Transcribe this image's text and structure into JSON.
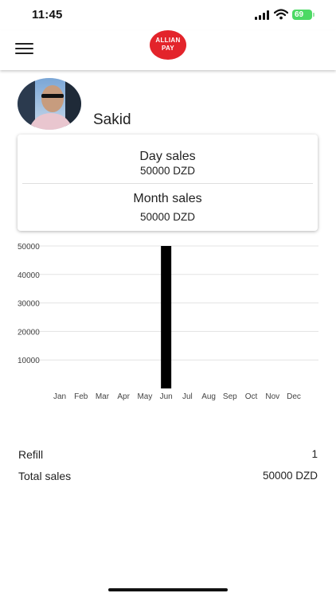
{
  "status_bar": {
    "time": "11:45",
    "battery_level": "69",
    "battery_color": "#4cd964"
  },
  "header": {
    "logo_line1": "ALLIAN",
    "logo_line2": "PAY",
    "brand_color": "#e3242b",
    "menu_icon": "hamburger-icon"
  },
  "profile": {
    "name": "Sakid"
  },
  "sales_card": {
    "day_label": "Day sales",
    "day_value": "50000 DZD",
    "month_label": "Month sales",
    "month_value": "50000 DZD"
  },
  "chart_data": {
    "type": "bar",
    "categories": [
      "Jan",
      "Feb",
      "Mar",
      "Apr",
      "May",
      "Jun",
      "Jul",
      "Aug",
      "Sep",
      "Oct",
      "Nov",
      "Dec"
    ],
    "values": [
      0,
      0,
      0,
      0,
      0,
      50000,
      0,
      0,
      0,
      0,
      0,
      0
    ],
    "yticks": [
      10000,
      20000,
      30000,
      40000,
      50000
    ],
    "ylim": [
      0,
      50000
    ],
    "title": "",
    "xlabel": "",
    "ylabel": "",
    "bar_color": "#000000",
    "grid": true
  },
  "summary": {
    "refill_label": "Refill",
    "refill_value": "1",
    "total_label": "Total sales",
    "total_value": "50000 DZD"
  }
}
